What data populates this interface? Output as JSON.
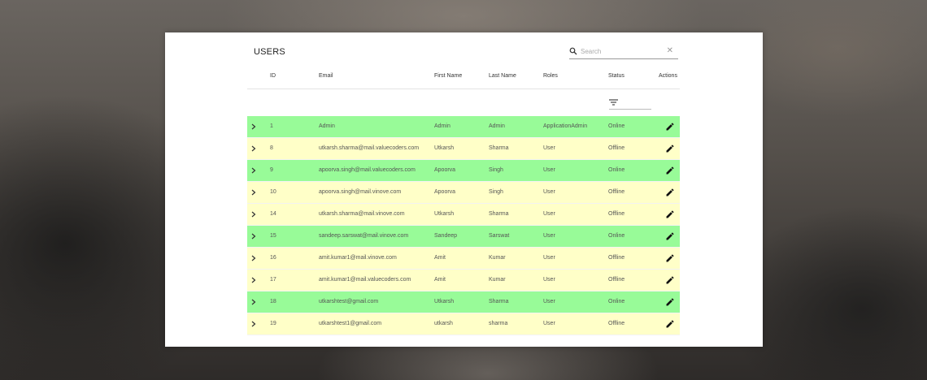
{
  "page": {
    "title": "USERS",
    "search": {
      "placeholder": "Search",
      "value": "",
      "clear_icon": "close-icon"
    }
  },
  "colors": {
    "online_row": "#98fb98",
    "offline_row": "#ffffc8",
    "card_background": "#ffffff"
  },
  "table": {
    "headers": {
      "id": "ID",
      "email": "Email",
      "first_name": "First Name",
      "last_name": "Last Name",
      "roles": "Roles",
      "status": "Status",
      "actions": "Actions"
    },
    "status_filter_icon": "filter-icon",
    "rows": [
      {
        "id": "1",
        "email": "Admin",
        "first_name": "Admin",
        "last_name": "Admin",
        "role": "ApplicationAdmin",
        "status": "Online"
      },
      {
        "id": "8",
        "email": "utkarsh.sharma@mail.valuecoders.com",
        "first_name": "Utkarsh",
        "last_name": "Sharma",
        "role": "User",
        "status": "Offline"
      },
      {
        "id": "9",
        "email": "apoorva.singh@mail.valuecoders.com",
        "first_name": "Apoorva",
        "last_name": "Singh",
        "role": "User",
        "status": "Online"
      },
      {
        "id": "10",
        "email": "apoorva.singh@mail.vinove.com",
        "first_name": "Apoorva",
        "last_name": "Singh",
        "role": "User",
        "status": "Offline"
      },
      {
        "id": "14",
        "email": "utkarsh.sharma@mail.vinove.com",
        "first_name": "Utkarsh",
        "last_name": "Sharma",
        "role": "User",
        "status": "Offline"
      },
      {
        "id": "15",
        "email": "sandeep.sarswat@mail.vinove.com",
        "first_name": "Sandeep",
        "last_name": "Sarswat",
        "role": "User",
        "status": "Online"
      },
      {
        "id": "16",
        "email": "amit.kumar1@mail.vinove.com",
        "first_name": "Amit",
        "last_name": "Kumar",
        "role": "User",
        "status": "Offline"
      },
      {
        "id": "17",
        "email": "amit.kumar1@mail.valuecoders.com",
        "first_name": "Amit",
        "last_name": "Kumar",
        "role": "User",
        "status": "Offline"
      },
      {
        "id": "18",
        "email": "utkarshtest@gmail.com",
        "first_name": "Utkarsh",
        "last_name": "Sharma",
        "role": "User",
        "status": "Online"
      },
      {
        "id": "19",
        "email": "utkarshtest1@gmail.com",
        "first_name": "utkarsh",
        "last_name": "sharma",
        "role": "User",
        "status": "Offline"
      }
    ],
    "row_icons": {
      "expand": "chevron-right-icon",
      "edit": "pencil-icon"
    }
  }
}
